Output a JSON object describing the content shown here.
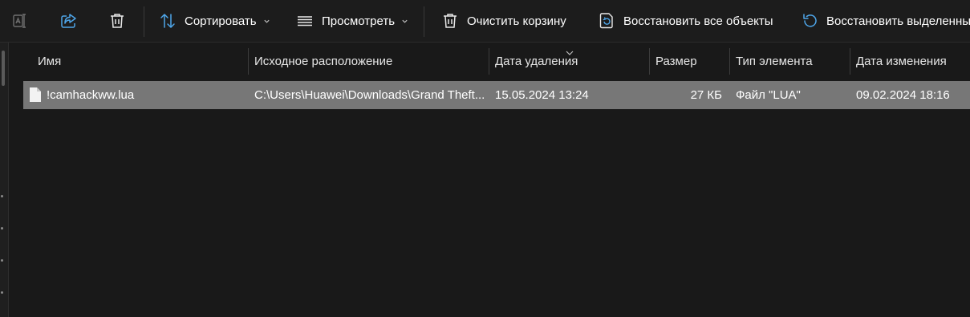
{
  "toolbar": {
    "sort_label": "Сортировать",
    "view_label": "Просмотреть",
    "empty_bin_label": "Очистить корзину",
    "restore_all_label": "Восстановить все объекты",
    "restore_selected_label": "Восстановить выделенные",
    "accent_color": "#4ea6ea"
  },
  "columns": [
    "Имя",
    "Исходное расположение",
    "Дата удаления",
    "Размер",
    "Тип элемента",
    "Дата изменения"
  ],
  "rows": [
    {
      "name": "!camhackww.lua",
      "original_location": "C:\\Users\\Huawei\\Downloads\\Grand Theft...",
      "date_deleted": "15.05.2024 13:24",
      "size": "27 КБ",
      "item_type": "Файл \"LUA\"",
      "date_modified": "09.02.2024 18:16",
      "icon": "file-icon"
    }
  ]
}
